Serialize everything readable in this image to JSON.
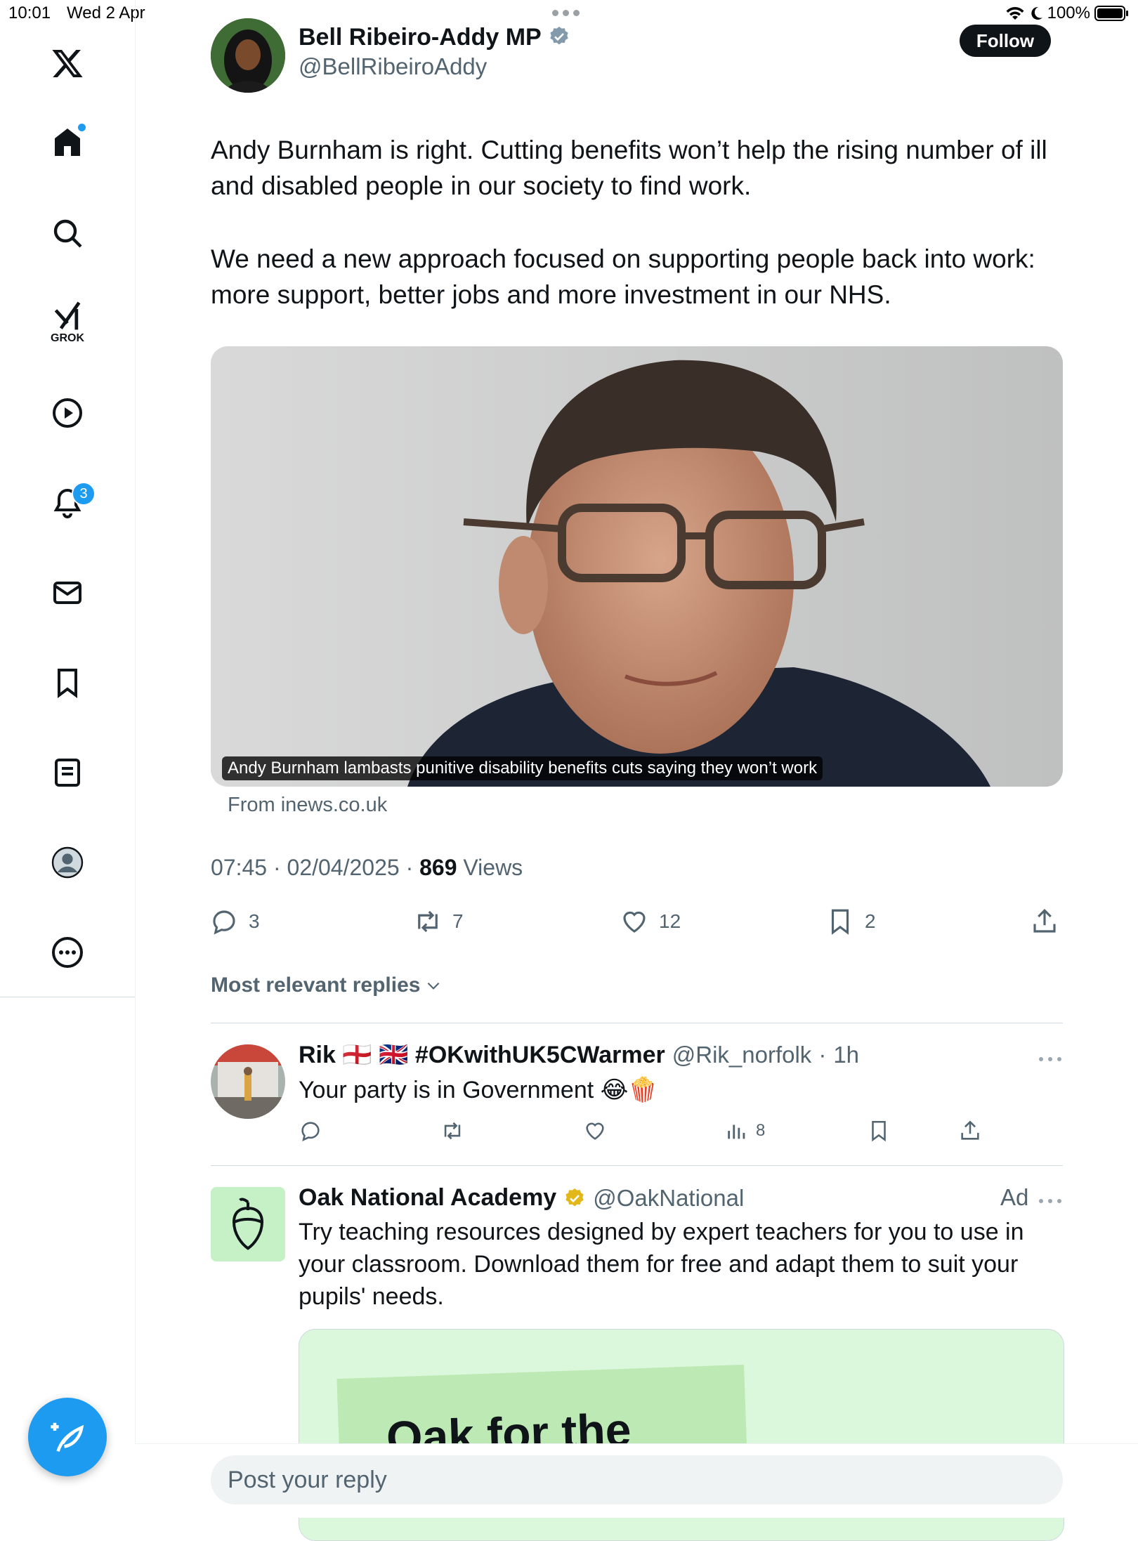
{
  "status_bar": {
    "time": "10:01",
    "date": "Wed 2 Apr",
    "battery": "100%"
  },
  "sidebar": {
    "items": [
      {
        "name": "x-logo-icon"
      },
      {
        "name": "home-icon"
      },
      {
        "name": "search-icon"
      },
      {
        "name": "grok-icon",
        "label": "GROK"
      },
      {
        "name": "video-icon"
      },
      {
        "name": "notifications-icon",
        "badge": "3"
      },
      {
        "name": "messages-icon"
      },
      {
        "name": "bookmarks-icon"
      },
      {
        "name": "lists-icon"
      },
      {
        "name": "profile-icon"
      },
      {
        "name": "more-icon"
      }
    ]
  },
  "tweet": {
    "author_name": "Bell Ribeiro-Addy MP",
    "author_handle": "@BellRibeiroAddy",
    "follow_label": "Follow",
    "paragraph1": "Andy Burnham is right. Cutting benefits won’t help the rising number of ill and disabled people in our society to find work.",
    "paragraph2": "We need a new approach focused on supporting people back into work: more support, better jobs and more investment in our NHS.",
    "media_caption": "Andy Burnham lambasts punitive disability benefits cuts saying they won’t work",
    "media_source": "From inews.co.uk",
    "time": "07:45",
    "date": "02/04/2025",
    "views_count": "869",
    "views_label": "Views",
    "replies": "3",
    "reposts": "7",
    "likes": "12",
    "bookmarks": "2"
  },
  "replies_section": {
    "sort_label": "Most relevant replies"
  },
  "reply1": {
    "name": "Rik 🏴󠁧󠁢󠁥󠁮󠁧󠁿 🇬🇧 #OKwithUK5CWarmer",
    "handle": "@Rik_norfolk",
    "time": "1h",
    "text": "Your party is in Government 😂🍿",
    "views": "8"
  },
  "ad": {
    "name": "Oak National Academy",
    "handle": "@OakNational",
    "ad_label": "Ad",
    "text": "Try teaching resources designed by expert teachers for you to use in your classroom. Download them for free and adapt them to suit your pupils' needs.",
    "card_text": "Oak for the"
  },
  "reply_box": {
    "placeholder": "Post your reply"
  },
  "colors": {
    "accent": "#1d9bf0",
    "text": "#0f1419",
    "muted": "#536471",
    "ad_green": "#c6f1c6"
  }
}
